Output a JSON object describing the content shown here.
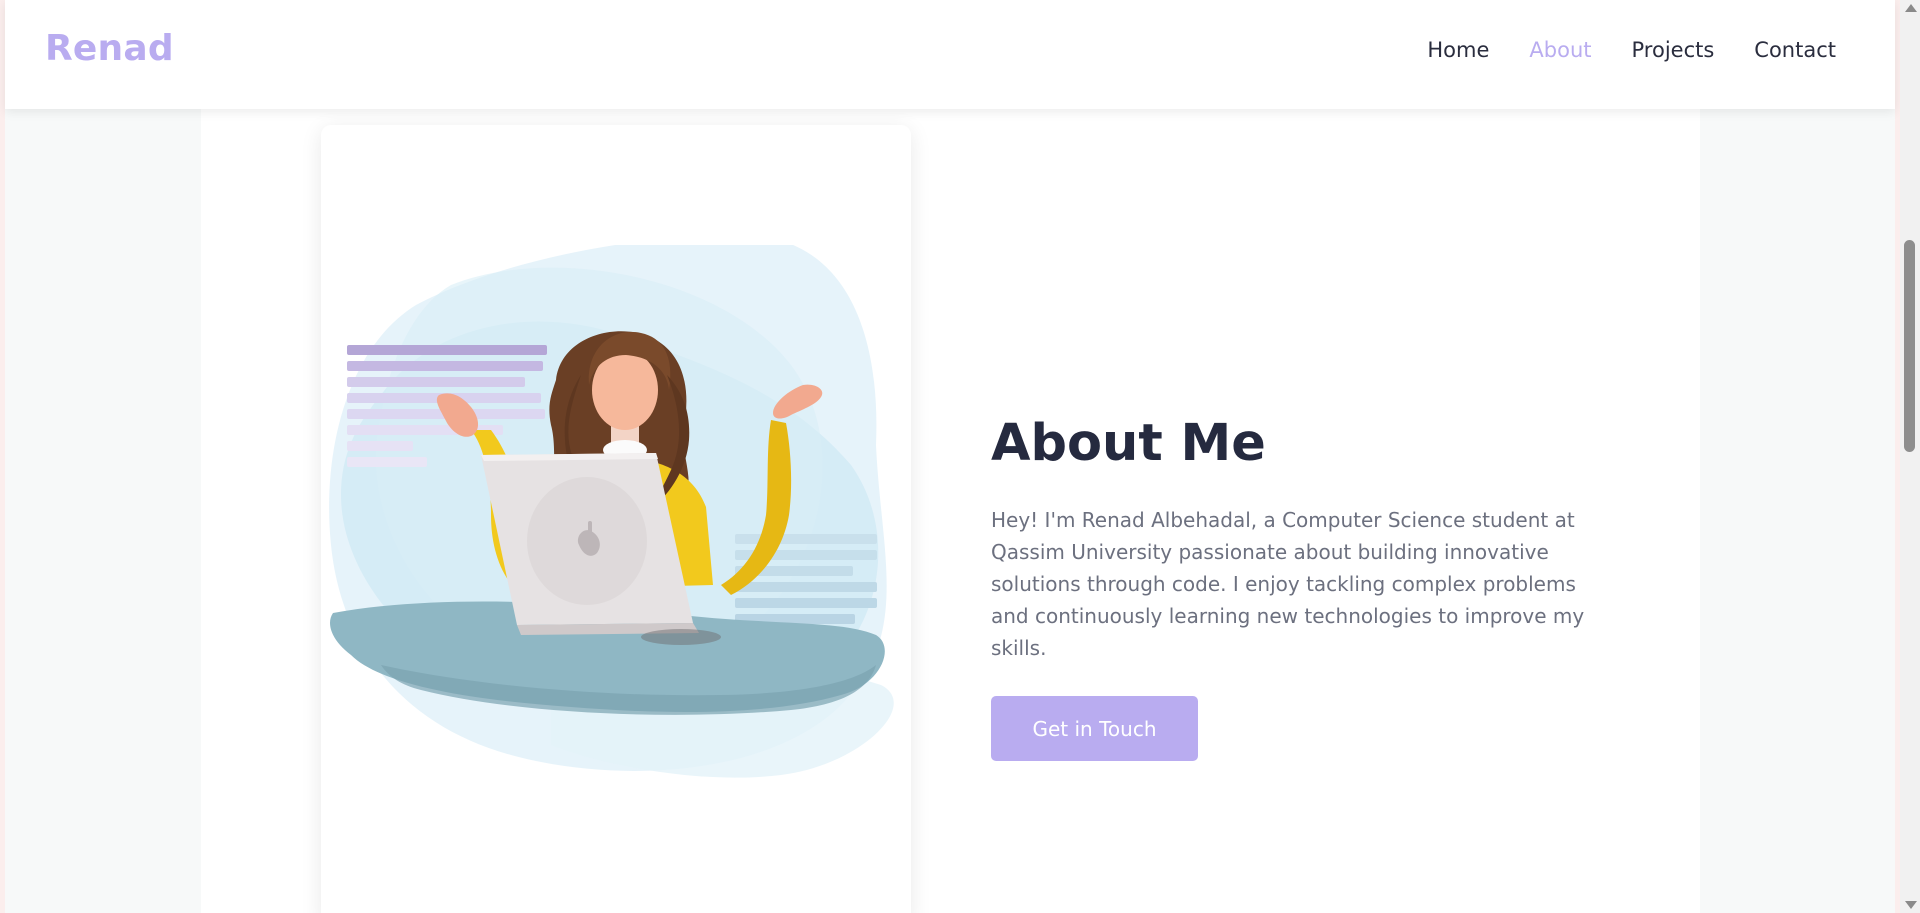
{
  "brand": {
    "name": "Renad"
  },
  "nav": {
    "items": [
      {
        "label": "Home"
      },
      {
        "label": "About",
        "active": true
      },
      {
        "label": "Projects"
      },
      {
        "label": "Contact"
      }
    ]
  },
  "about": {
    "title": "About Me",
    "description": "Hey! I'm Renad Albehadal, a Computer Science student at Qassim University passionate about building innovative solutions through code. I enjoy tackling complex problems and continuously learning new technologies to improve my skills.",
    "cta_label": "Get in Touch"
  },
  "illustration": {
    "icon": "girl-with-laptop-illustration"
  },
  "colors": {
    "accent": "#b9acf0",
    "heading": "#252a3f",
    "body_text": "#6c707f"
  }
}
